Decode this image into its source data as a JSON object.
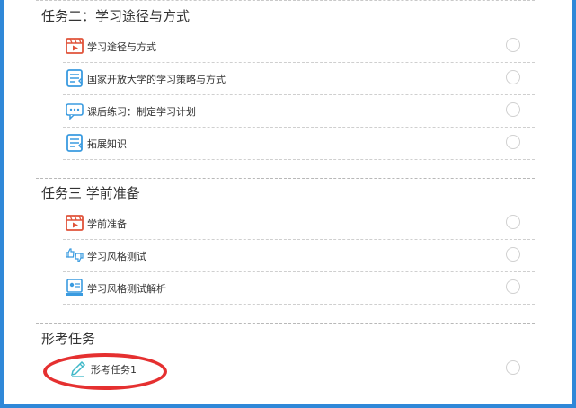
{
  "sections": [
    {
      "title": "任务二：学习途径与方式",
      "items": [
        {
          "label": "学习途径与方式",
          "icon": "video-icon"
        },
        {
          "label": "国家开放大学的学习策略与方式",
          "icon": "document-icon"
        },
        {
          "label": "课后练习：制定学习计划",
          "icon": "chat-icon"
        },
        {
          "label": "拓展知识",
          "icon": "document-icon"
        }
      ]
    },
    {
      "title": "任务三 学前准备",
      "items": [
        {
          "label": "学前准备",
          "icon": "video-icon"
        },
        {
          "label": "学习风格测试",
          "icon": "thumbs-icon"
        },
        {
          "label": "学习风格测试解析",
          "icon": "id-card-icon"
        }
      ]
    },
    {
      "title": "形考任务",
      "items": [
        {
          "label": "形考任务1",
          "icon": "pencil-icon"
        }
      ]
    }
  ],
  "colors": {
    "frame": "#2f88d8",
    "video_icon": "#e0533a",
    "doc_icon": "#3a9be0",
    "highlight": "#e53030"
  }
}
